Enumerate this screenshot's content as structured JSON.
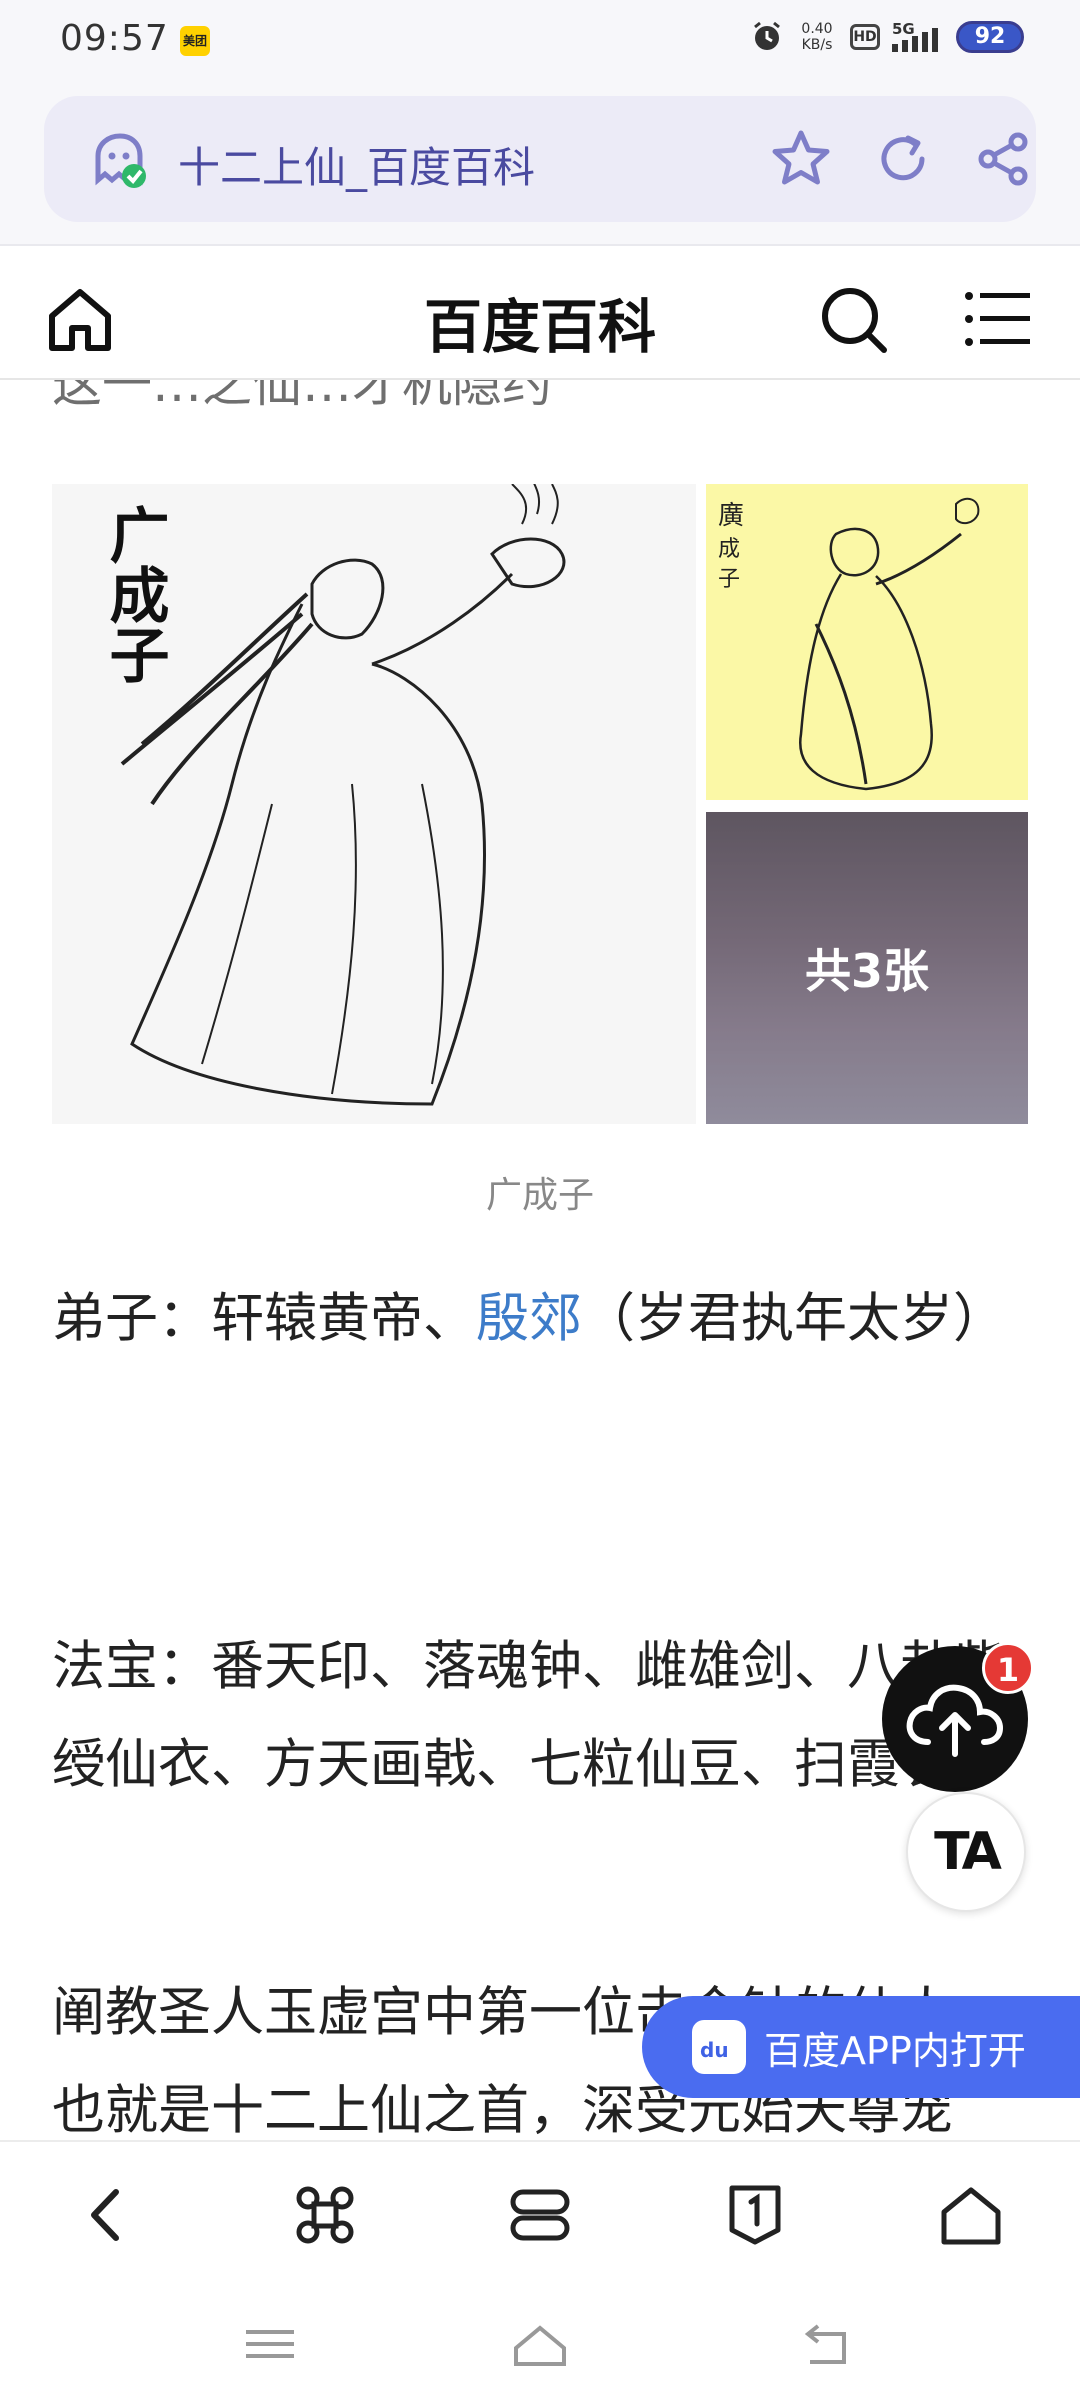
{
  "status_bar": {
    "time": "09:57",
    "app_badge": "美团",
    "net_speed_value": "0.40",
    "net_speed_unit": "KB/s",
    "hd_label": "HD",
    "signal_label": "5G",
    "battery": "92"
  },
  "browser": {
    "url_title": "十二上仙_百度百科"
  },
  "site_header": {
    "title": "百度百科"
  },
  "content": {
    "cut_text": "这一…之仙…才机隐约",
    "image_main_label": "广成子",
    "image_count_label": "共3张",
    "image_caption": "广成子",
    "paragraph_1_prefix": "弟子：轩辕黄帝、",
    "paragraph_1_link": "殷郊",
    "paragraph_1_suffix": "（岁君执年太岁）",
    "paragraph_2": "法宝：番天印、落魂钟、雌雄剑、八卦紫绶仙衣、方天画戟、七粒仙豆、扫霞衣。",
    "paragraph_3": "阐教圣人玉虚宫中第一位击金钟的仙人，也就是十二上仙之首，深受元始天尊宠爱，修行于九仙山桃源洞。"
  },
  "floating": {
    "upload_badge": "1",
    "ta_label": "TA",
    "open_app_label": "百度APP内打开",
    "open_app_icon_text": "du"
  }
}
